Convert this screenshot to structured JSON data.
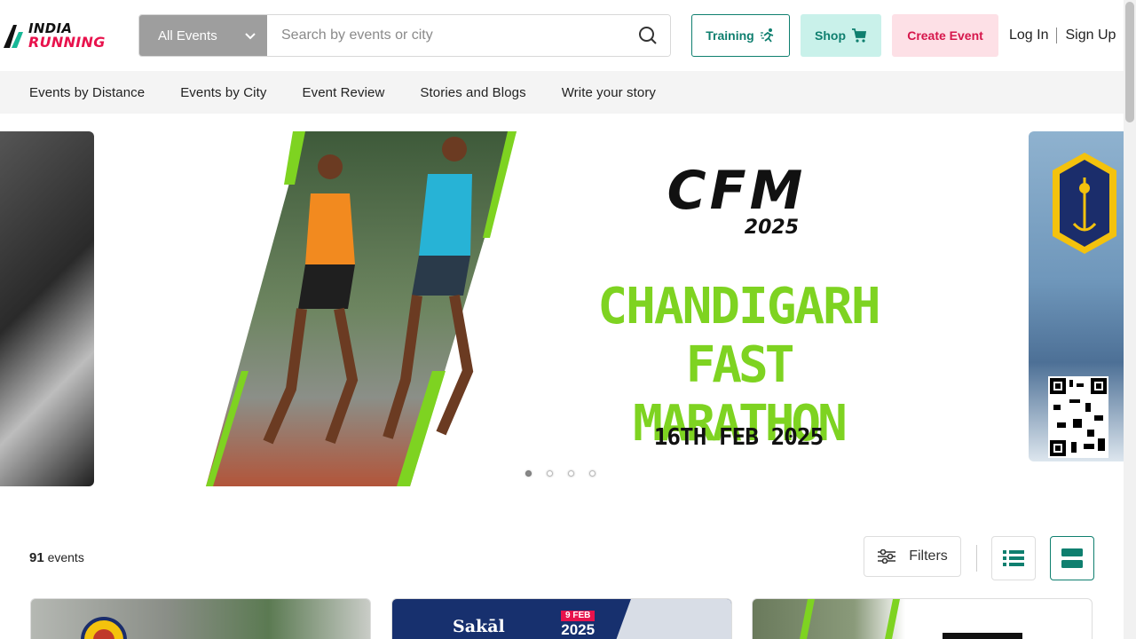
{
  "header": {
    "logo": {
      "line1": "INDIA",
      "line2": "RUNNING"
    },
    "search": {
      "category": "All Events",
      "placeholder": "Search by events or city"
    },
    "buttons": {
      "training": "Training",
      "shop": "Shop",
      "create_event": "Create Event"
    },
    "auth": {
      "login": "Log In",
      "signup": "Sign Up"
    }
  },
  "nav": {
    "items": [
      {
        "label": "Events by Distance"
      },
      {
        "label": "Events by City"
      },
      {
        "label": "Event Review"
      },
      {
        "label": "Stories and Blogs"
      },
      {
        "label": "Write your story"
      }
    ]
  },
  "carousel": {
    "slide": {
      "logo": "CFM",
      "logo_year": "2025",
      "title_line1": "CHANDIGARH",
      "title_line2": "FAST MARATHON",
      "date": "16TH FEB 2025"
    },
    "dots": 4,
    "active_dot": 1
  },
  "events": {
    "count": "91",
    "count_label": "events",
    "filters_label": "Filters"
  },
  "cards": [
    {
      "label": ""
    },
    {
      "brand": "Sakāl",
      "date": "9 FEB",
      "year": "2025"
    },
    {
      "label": ""
    }
  ],
  "colors": {
    "accent_teal": "#0f7f6f",
    "accent_pink": "#d6164b",
    "shop_bg": "#c9f1ea",
    "create_bg": "#fde0e6",
    "cfm_green": "#7ed321"
  }
}
